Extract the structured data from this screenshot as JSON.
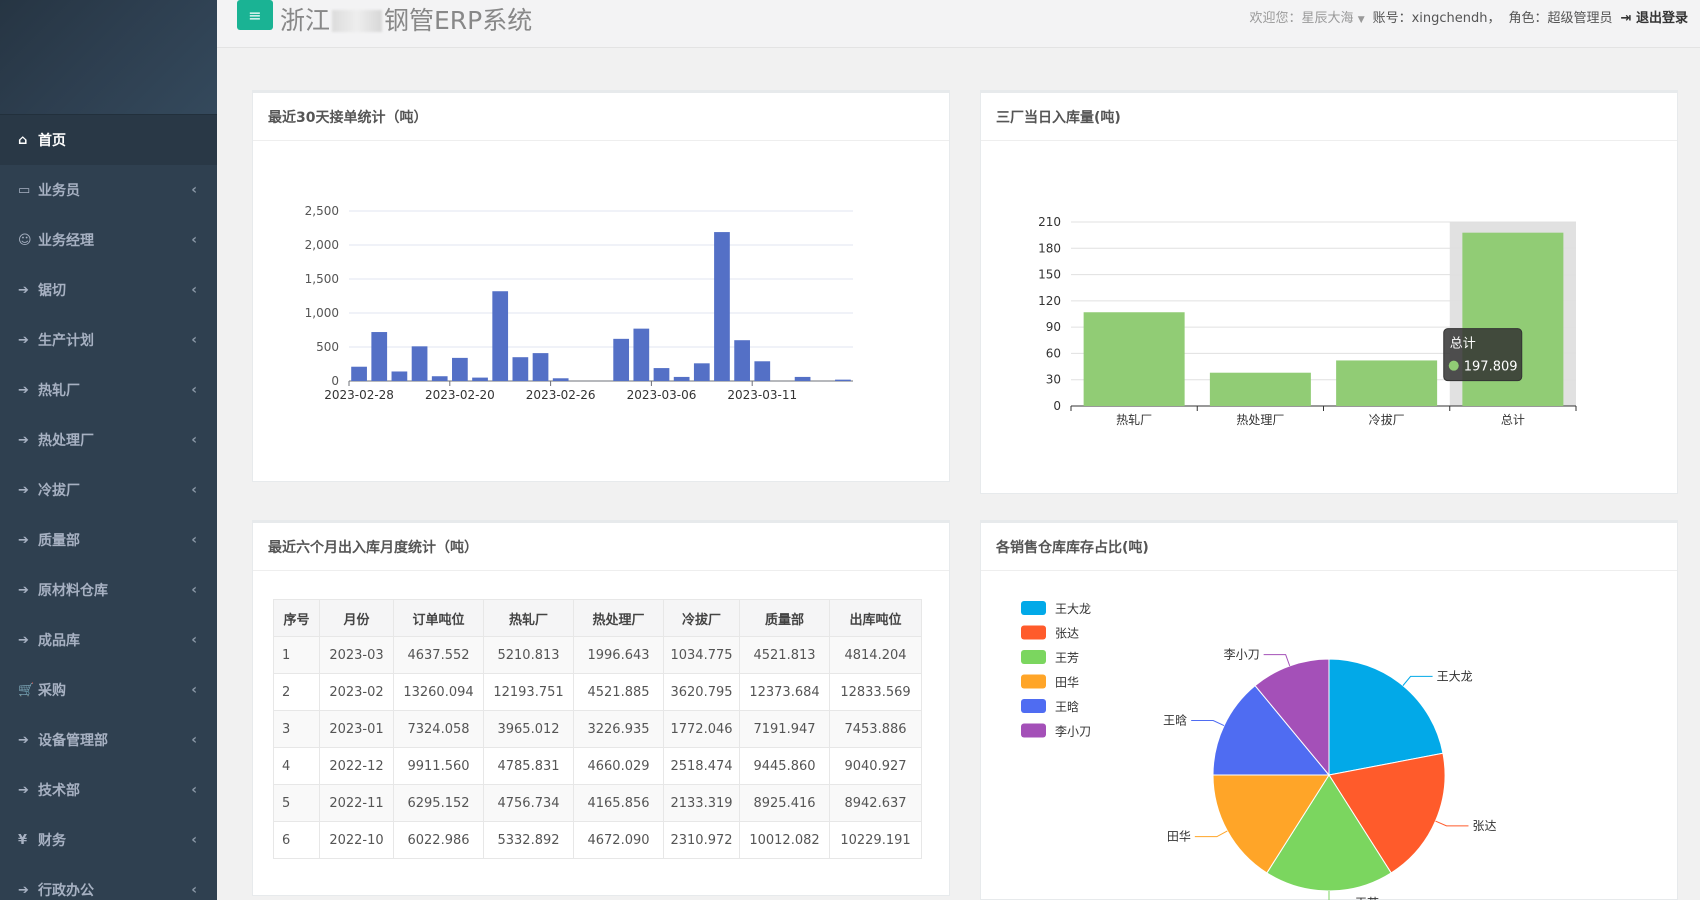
{
  "header": {
    "title_prefix": "浙江",
    "title_suffix": "钢管ERP系统",
    "menu_icon": "≡",
    "welcome_label": "欢迎您：",
    "welcome_name": "星辰大海",
    "account": "账号：xingchendh，",
    "role": "角色：超级管理员",
    "logout_label": "退出登录"
  },
  "sidebar": {
    "items": [
      {
        "label": "首页",
        "icon": "⌂",
        "active": true
      },
      {
        "label": "业务员",
        "icon": "▭"
      },
      {
        "label": "业务经理",
        "icon": "☺"
      },
      {
        "label": "锯切",
        "icon": "➔"
      },
      {
        "label": "生产计划",
        "icon": "➔"
      },
      {
        "label": "热轧厂",
        "icon": "➔"
      },
      {
        "label": "热处理厂",
        "icon": "➔"
      },
      {
        "label": "冷拔厂",
        "icon": "➔"
      },
      {
        "label": "质量部",
        "icon": "➔"
      },
      {
        "label": "原材料仓库",
        "icon": "➔"
      },
      {
        "label": "成品库",
        "icon": "➔"
      },
      {
        "label": "采购",
        "icon": "🛒"
      },
      {
        "label": "设备管理部",
        "icon": "➔"
      },
      {
        "label": "技术部",
        "icon": "➔"
      },
      {
        "label": "财务",
        "icon": "¥"
      },
      {
        "label": "行政办公",
        "icon": "➔"
      }
    ],
    "chevron": "‹"
  },
  "panels": {
    "orders_title": "最近30天接单统计（吨）",
    "warehouse_title": "三厂当日入库量(吨)",
    "monthly_title": "最近六个月出入库月度统计（吨）",
    "pie_title": "各销售仓库库存占比(吨)"
  },
  "chart_data": [
    {
      "type": "bar",
      "name": "orders",
      "x_ticks": [
        "2023-02-28",
        "2023-02-20",
        "2023-02-26",
        "2023-03-06",
        "2023-03-11"
      ],
      "values": [
        210,
        720,
        140,
        510,
        70,
        340,
        50,
        1320,
        350,
        410,
        40,
        0,
        0,
        620,
        770,
        190,
        60,
        260,
        2190,
        600,
        290,
        0,
        60,
        0,
        20
      ],
      "y_ticks": [
        "0",
        "500",
        "1,000",
        "1,500",
        "2,000",
        "2,500"
      ],
      "ylim": [
        0,
        2500
      ],
      "color": "#5470c6"
    },
    {
      "type": "bar",
      "name": "warehouse",
      "categories": [
        "热轧厂",
        "热处理厂",
        "冷拔厂",
        "总计"
      ],
      "values": [
        107,
        38,
        52,
        197.809
      ],
      "y_ticks": [
        "0",
        "30",
        "60",
        "90",
        "120",
        "150",
        "180",
        "210"
      ],
      "ylim": [
        0,
        210
      ],
      "color": "#91cc75",
      "tooltip": {
        "title": "总计",
        "value": "197.809"
      }
    },
    {
      "type": "pie",
      "name": "inventory",
      "labels": [
        "王大龙",
        "张达",
        "王芳",
        "田华",
        "王晗",
        "李小刀"
      ],
      "values": [
        22,
        19,
        18,
        16,
        14,
        11
      ],
      "colors": [
        "#02a9e8",
        "#ff5b2b",
        "#7bd65f",
        "#ffa528",
        "#4f6cf2",
        "#a450b8"
      ]
    }
  ],
  "monthly_table": {
    "headers": [
      "序号",
      "月份",
      "订单吨位",
      "热轧厂",
      "热处理厂",
      "冷拔厂",
      "质量部",
      "出库吨位"
    ],
    "rows": [
      [
        "1",
        "2023-03",
        "4637.552",
        "5210.813",
        "1996.643",
        "1034.775",
        "4521.813",
        "4814.204"
      ],
      [
        "2",
        "2023-02",
        "13260.094",
        "12193.751",
        "4521.885",
        "3620.795",
        "12373.684",
        "12833.569"
      ],
      [
        "3",
        "2023-01",
        "7324.058",
        "3965.012",
        "3226.935",
        "1772.046",
        "7191.947",
        "7453.886"
      ],
      [
        "4",
        "2022-12",
        "9911.560",
        "4785.831",
        "4660.029",
        "2518.474",
        "9445.860",
        "9040.927"
      ],
      [
        "5",
        "2022-11",
        "6295.152",
        "4756.734",
        "4165.856",
        "2133.319",
        "8925.416",
        "8942.637"
      ],
      [
        "6",
        "2022-10",
        "6022.986",
        "5332.892",
        "4672.090",
        "2310.972",
        "10012.082",
        "10229.191"
      ]
    ]
  }
}
